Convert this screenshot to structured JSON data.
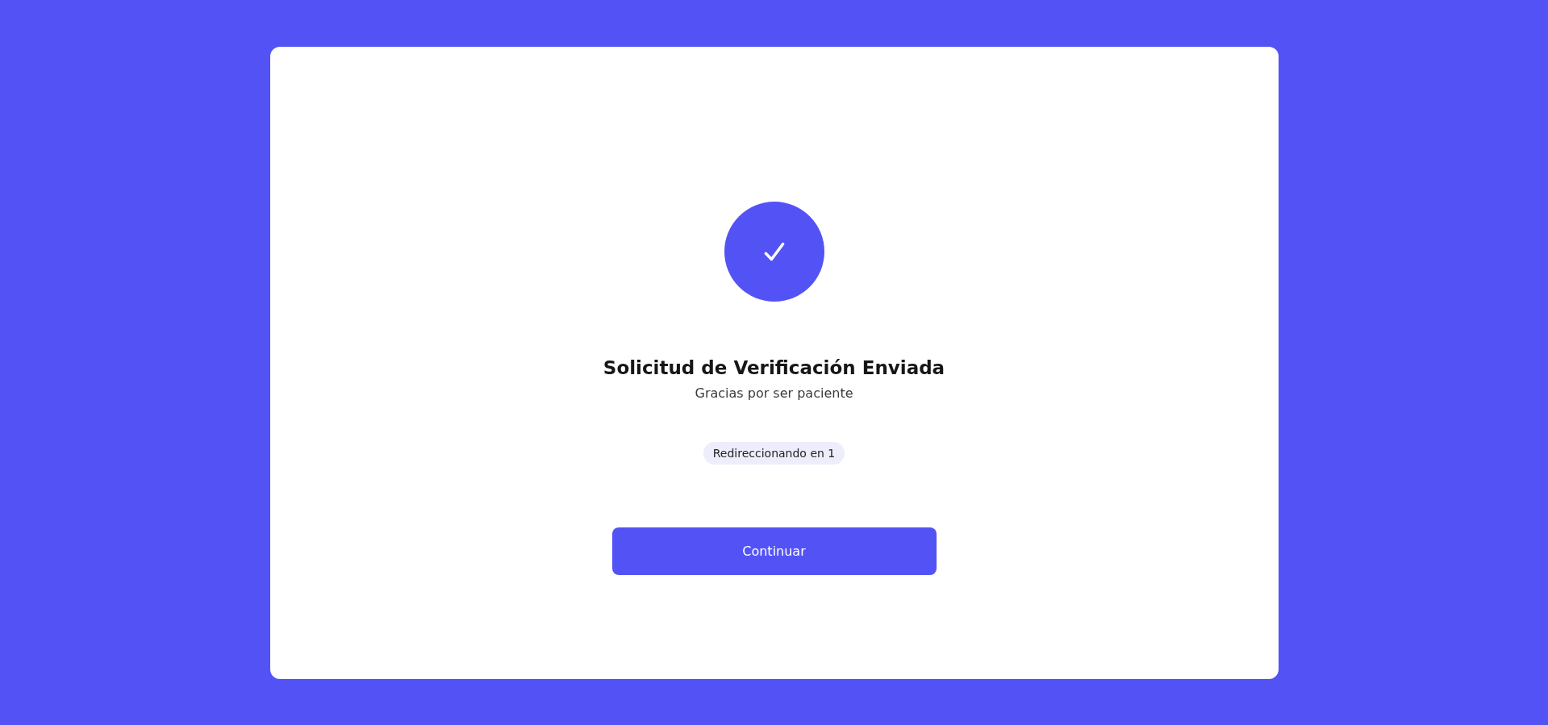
{
  "card": {
    "kind": "success",
    "title": "Solicitud de Verificación Enviada",
    "subtitle": "Gracias por ser paciente",
    "badge": "Redireccionando en 1",
    "button": "Continuar"
  }
}
